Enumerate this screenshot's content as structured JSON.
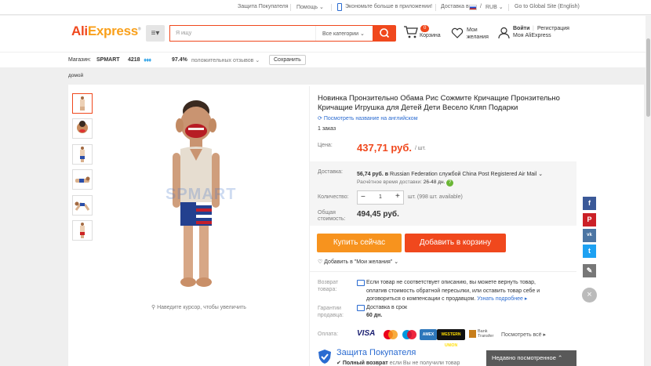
{
  "topbar": {
    "buyer_protection": "Защита Покупателя",
    "help": "Помощь",
    "app_promo": "Экономьте больше в приложении!",
    "ship_to": "Доставка в",
    "currency": "RUB",
    "global_site": "Go to Global Site (English)"
  },
  "header": {
    "logo_ali": "Ali",
    "logo_express": "Express",
    "search_placeholder": "Я ищу",
    "all_categories": "Все категории",
    "cart_count": "0",
    "cart_label": "Корзина",
    "wishlist_line1": "Мои",
    "wishlist_line2": "желания",
    "login": "Войти",
    "register": "Регистрация",
    "my_account": "Моя AliExpress"
  },
  "store": {
    "label": "Магазин:",
    "name": "SPMART",
    "rating_number": "4218",
    "positive_percent": "97.4%",
    "positive_label": "положительных отзывов",
    "save": "Сохранить"
  },
  "breadcrumb": {
    "home": "домой"
  },
  "gallery": {
    "watermark": "SPMART",
    "zoom_hint": "Наведите курсор, чтобы увеличить"
  },
  "product": {
    "title": "Новинка Пронзительно Обама Рис Сожмите Кричащие Пронзительно Кричащие Игрушка для Детей Дети Весело Кляп Подарки",
    "english_link": "Посмотреть название на английском",
    "orders": "1 заказ",
    "price_label": "Цена:",
    "price": "437,71 руб.",
    "per_unit": "/ шт.",
    "shipping_label": "Доставка:",
    "shipping_price": "56,74 руб. в",
    "shipping_dest": "Russian Federation службой China Post Registered Air Mail",
    "delivery_time_label": "Расчётное время доставки:",
    "delivery_time": "26-48 дн.",
    "quantity_label": "Количество:",
    "quantity": "1",
    "stock": "шт. (998 шт. available)",
    "total_label_1": "Общая",
    "total_label_2": "стоимость:",
    "total": "494,45 руб.",
    "buy_now": "Купить сейчас",
    "add_to_cart": "Добавить в корзину",
    "wishlist_add": "Добавить в \"Мои желания\"",
    "returns_label_1": "Возврат",
    "returns_label_2": "товара:",
    "returns_text_1": "Если товар не соответствует описанию, вы можете вернуть товар,",
    "returns_text_2": "оплатив стоимость обратной пересылки, или оставить товар себе и",
    "returns_text_3": "договориться о компенсации с продавцом.",
    "learn_more": "Узнать подробнее",
    "guarantee_label_1": "Гарантии",
    "guarantee_label_2": "продавца:",
    "guarantee_text": "Доставка в срок",
    "guarantee_days": "60 дн.",
    "payment_label": "Оплата:",
    "see_all": "Посмотреть всё",
    "payment_methods": [
      "VISA",
      "Mastercard",
      "Maestro",
      "AmEx",
      "Western Union",
      "Bank Transfer"
    ],
    "protection_title": "Защита Покупателя",
    "protection_refund": "Полный возврат",
    "protection_refund_tail": "если Вы не получили товар"
  },
  "recently_viewed": "Недавно посмотренное",
  "colors": {
    "accent": "#f0481d",
    "orange": "#f7931e",
    "price": "#f0481d",
    "link": "#2a6bd1"
  },
  "share_icons": [
    "facebook-icon",
    "pinterest-icon",
    "vk-icon",
    "twitter-icon",
    "edit-icon"
  ]
}
